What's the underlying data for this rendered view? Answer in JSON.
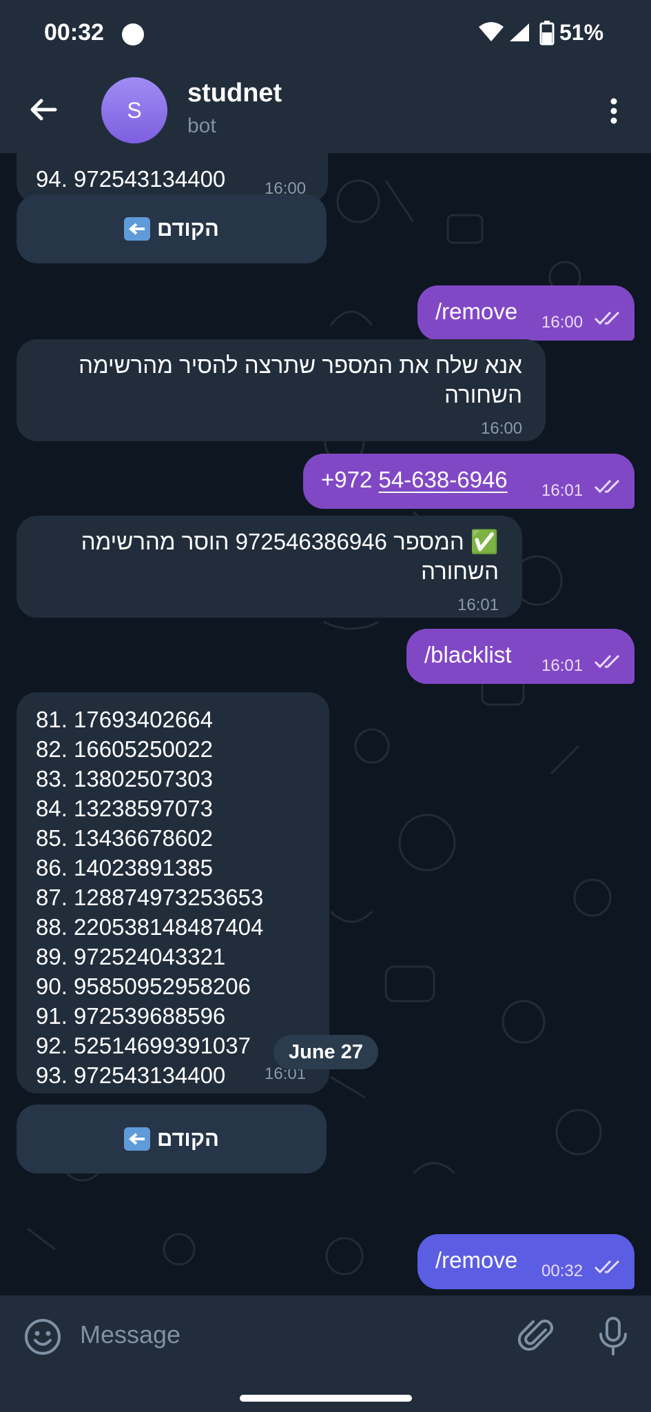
{
  "status_bar": {
    "time": "00:32",
    "battery": "51%"
  },
  "header": {
    "avatar_letter": "S",
    "title": "studnet",
    "subtitle": "bot"
  },
  "messages": {
    "top_partial": {
      "text": "94. 972543134400",
      "time": "16:00"
    },
    "keyboard_button_1": {
      "label": "הקודם"
    },
    "remove_cmd_1": {
      "text": "/remove",
      "time": "16:00"
    },
    "prompt_msg": {
      "line1": "אנא שלח את המספר שתרצה להסיר מהרשימה",
      "line2": "השחורה",
      "time": "16:00"
    },
    "number_msg": {
      "prefix": "+972 ",
      "number": "54-638-6946",
      "time": "16:01"
    },
    "removed_msg": {
      "emoji": "✅",
      "line1": "המספר 972546386946 הוסר מהרשימה",
      "line2": "השחורה",
      "time": "16:01"
    },
    "blacklist_cmd": {
      "text": "/blacklist",
      "time": "16:01"
    },
    "blacklist_list": {
      "items": [
        "81. 17693402664",
        "82. 16605250022",
        "83. 13802507303",
        "84. 13238597073",
        "85. 13436678602",
        "86. 14023891385",
        "87. 128874973253653",
        "88. 220538148487404",
        "89. 972524043321",
        "90. 95850952958206",
        "91. 972539688596",
        "92. 52514699391037",
        "93. 972543134400"
      ],
      "time": "16:01"
    },
    "keyboard_button_2": {
      "label": "הקודם"
    },
    "date_separator": "June 27",
    "remove_cmd_2": {
      "text": "/remove",
      "time": "00:32"
    }
  },
  "input": {
    "placeholder": "Message"
  },
  "colors": {
    "background": "#0e1621",
    "bar": "#212d3b",
    "incoming": "#212d3b",
    "outgoing": "#8148c6",
    "outgoing_latest": "#5b5de3",
    "keyboard_button": "#263547"
  },
  "icons": [
    "back-arrow-icon",
    "more-vert-icon",
    "emoji-icon",
    "attach-icon",
    "mic-icon",
    "double-check-icon",
    "left-arrow-emoji-icon",
    "wifi-icon",
    "signal-icon",
    "battery-icon"
  ]
}
